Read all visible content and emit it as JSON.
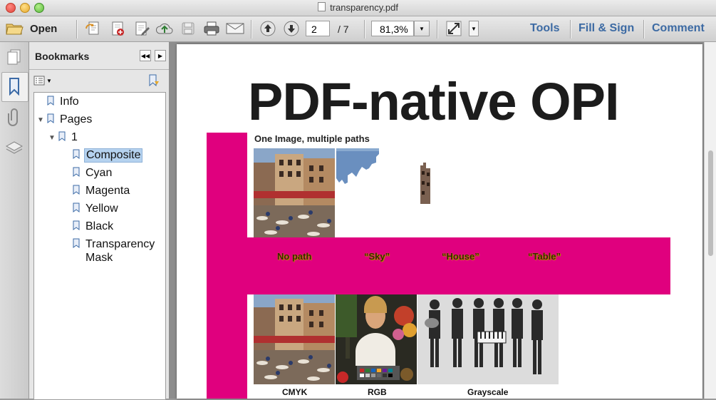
{
  "window": {
    "title": "transparency.pdf"
  },
  "toolbar": {
    "open_label": "Open",
    "current_page": "2",
    "page_count_text": "/  7",
    "zoom_value": "81,3%",
    "tools_label": "Tools",
    "fill_sign_label": "Fill & Sign",
    "comment_label": "Comment"
  },
  "bookmarks": {
    "header": "Bookmarks",
    "items": [
      {
        "label": "Info",
        "level": 0
      },
      {
        "label": "Pages",
        "level": 0
      },
      {
        "label": "1",
        "level": 1
      },
      {
        "label": "Composite",
        "level": 2,
        "selected": true
      },
      {
        "label": "Cyan",
        "level": 2
      },
      {
        "label": "Magenta",
        "level": 2
      },
      {
        "label": "Yellow",
        "level": 2
      },
      {
        "label": "Black",
        "level": 2
      },
      {
        "label": "Transparency",
        "label2": "Mask",
        "level": 2
      }
    ]
  },
  "document": {
    "title": "PDF-native OPI",
    "subtitle": "One Image, multiple paths",
    "path_labels": [
      "No path",
      "“Sky”",
      "“House”",
      "“Table”"
    ],
    "color_labels": [
      "CMYK",
      "RGB",
      "Grayscale"
    ],
    "accent_color": "#e0007e"
  }
}
